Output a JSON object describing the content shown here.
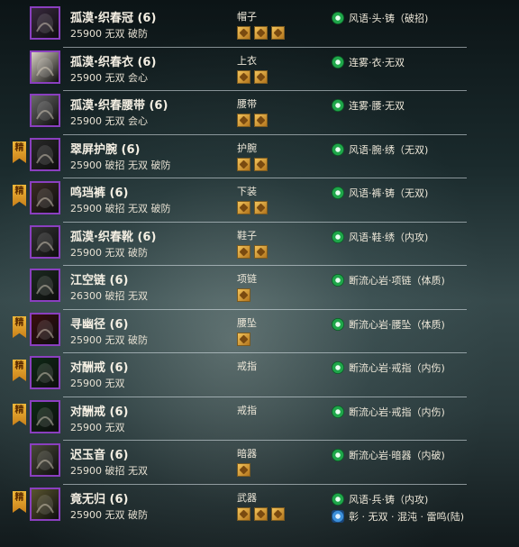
{
  "rows": [
    {
      "name": "孤漠·织春冠 (6)",
      "stats": "25900 无双 破防",
      "slot": "帽子",
      "gems": 3,
      "tag": false,
      "enchants": [
        {
          "text": "风语·头·铸（破招)",
          "color": "green"
        }
      ],
      "icon": "hat-icon",
      "icon_bg": "#3a2a40"
    },
    {
      "name": "孤漠·织春衣 (6)",
      "stats": "25900 无双 会心",
      "slot": "上衣",
      "gems": 2,
      "tag": false,
      "enchants": [
        {
          "text": "连雾·衣·无双",
          "color": "green"
        }
      ],
      "icon": "robe-icon",
      "icon_bg": "#d9d2c4"
    },
    {
      "name": "孤漠·织春腰带 (6)",
      "stats": "25900 无双 会心",
      "slot": "腰带",
      "gems": 2,
      "tag": false,
      "enchants": [
        {
          "text": "连雾·腰·无双",
          "color": "green"
        }
      ],
      "icon": "belt-icon",
      "icon_bg": "#6a6a6a"
    },
    {
      "name": "翠屏护腕 (6)",
      "stats": "25900 破招 无双 破防",
      "slot": "护腕",
      "gems": 2,
      "tag": true,
      "enchants": [
        {
          "text": "风语·腕·绣（无双)",
          "color": "green"
        }
      ],
      "icon": "bracer-icon",
      "icon_bg": "#2a2a2a"
    },
    {
      "name": "鸣珰裤 (6)",
      "stats": "25900 破招 无双 破防",
      "slot": "下装",
      "gems": 2,
      "tag": true,
      "enchants": [
        {
          "text": "风语·裤·铸（无双)",
          "color": "green"
        }
      ],
      "icon": "pants-icon",
      "icon_bg": "#3a2c24"
    },
    {
      "name": "孤漠·织春靴 (6)",
      "stats": "25900 无双 破防",
      "slot": "鞋子",
      "gems": 2,
      "tag": false,
      "enchants": [
        {
          "text": "风语·鞋·绣（内攻)",
          "color": "green"
        }
      ],
      "icon": "boots-icon",
      "icon_bg": "#333333"
    },
    {
      "name": "江空链 (6)",
      "stats": "26300 破招 无双",
      "slot": "项链",
      "gems": 1,
      "tag": false,
      "enchants": [
        {
          "text": "断流心岩·项链（体质)",
          "color": "green"
        }
      ],
      "icon": "necklace-icon",
      "icon_bg": "#1c2a20"
    },
    {
      "name": "寻幽径 (6)",
      "stats": "25900 无双 破防",
      "slot": "腰坠",
      "gems": 1,
      "tag": true,
      "enchants": [
        {
          "text": "断流心岩·腰坠（体质)",
          "color": "green"
        }
      ],
      "icon": "pendant-icon",
      "icon_bg": "#3a0f10"
    },
    {
      "name": "对酬戒 (6)",
      "stats": "25900 无双",
      "slot": "戒指",
      "gems": 0,
      "tag": true,
      "enchants": [
        {
          "text": "断流心岩·戒指（内伤)",
          "color": "green"
        }
      ],
      "icon": "ring-icon",
      "icon_bg": "#0f2a16"
    },
    {
      "name": "对酬戒 (6)",
      "stats": "25900 无双",
      "slot": "戒指",
      "gems": 0,
      "tag": true,
      "enchants": [
        {
          "text": "断流心岩·戒指（内伤)",
          "color": "green"
        }
      ],
      "icon": "ring-icon",
      "icon_bg": "#0f2a16"
    },
    {
      "name": "迟玉音 (6)",
      "stats": "25900 破招 无双",
      "slot": "暗器",
      "gems": 1,
      "tag": false,
      "enchants": [
        {
          "text": "断流心岩·暗器（内破)",
          "color": "green"
        }
      ],
      "icon": "hidden-weapon-icon",
      "icon_bg": "#4a4a3a"
    },
    {
      "name": "竟无归 (6)",
      "stats": "25900 无双 破防",
      "slot": "武器",
      "gems": 3,
      "tag": true,
      "enchants": [
        {
          "text": "风语·兵·铸（内攻)",
          "color": "green"
        },
        {
          "text": "彰 · 无双 · 混沌 · 雷鸣(陆)",
          "color": "blue"
        }
      ],
      "icon": "weapon-icon",
      "icon_bg": "#5a5530"
    }
  ],
  "tag_label": "精"
}
